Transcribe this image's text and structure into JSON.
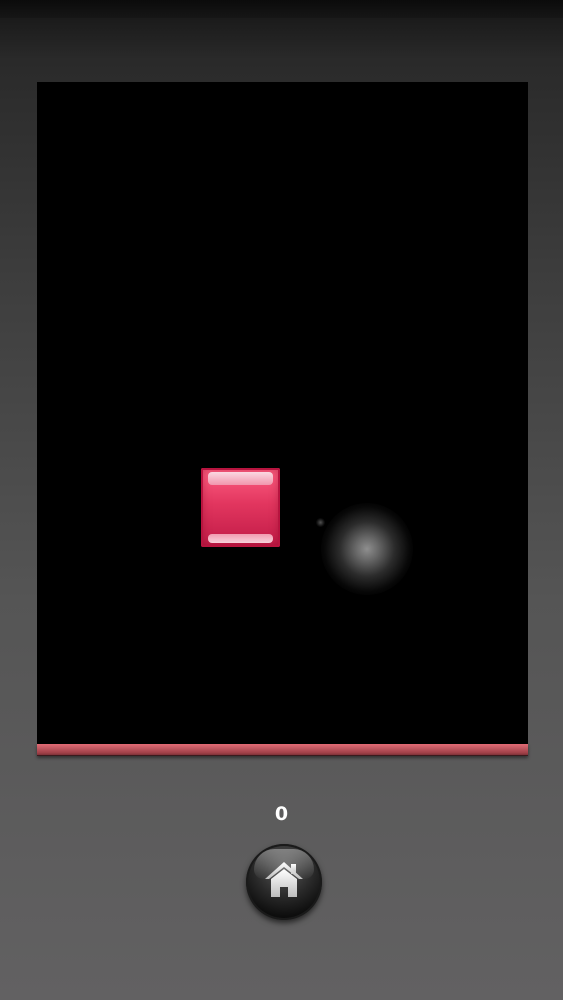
{
  "game": {
    "score": "0"
  },
  "colors": {
    "block": "#e2365f",
    "floor": "#c25a63",
    "playfield": "#000000"
  },
  "icons": {
    "home_button": "home-icon"
  }
}
